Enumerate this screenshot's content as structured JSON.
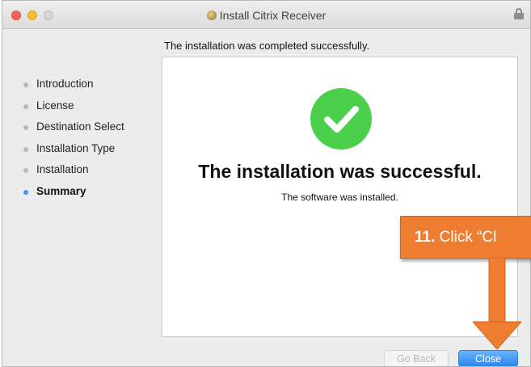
{
  "window": {
    "title": "Install Citrix Receiver"
  },
  "sidebar": {
    "steps": [
      {
        "label": "Introduction"
      },
      {
        "label": "License"
      },
      {
        "label": "Destination Select"
      },
      {
        "label": "Installation Type"
      },
      {
        "label": "Installation"
      },
      {
        "label": "Summary"
      }
    ]
  },
  "main": {
    "header": "The installation was completed successfully.",
    "title": "The installation was successful.",
    "subtitle": "The software was installed."
  },
  "buttons": {
    "back": "Go Back",
    "close": "Close"
  },
  "callout": {
    "number": "11.",
    "text": "Click  “Cl"
  },
  "colors": {
    "accent": "#3b99fc",
    "success": "#4cd04c",
    "callout": "#ee7d31"
  },
  "icons": {
    "success": "checkmark-circle-icon",
    "lock": "lock-icon",
    "app": "citrix-icon"
  }
}
